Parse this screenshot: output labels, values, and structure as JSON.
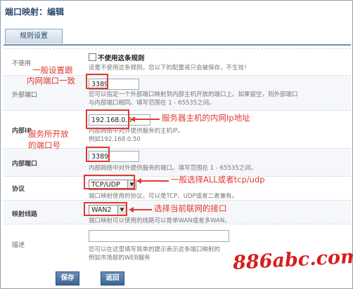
{
  "page": {
    "title": "端口映射：编辑"
  },
  "tabs": [
    {
      "label": "规则设置"
    }
  ],
  "rows": {
    "disable": {
      "label": "不使用",
      "checkbox_label": "不使用这条规则",
      "help": "设置不使用这条规则，您以下的配置将只会被保存，不生效！"
    },
    "external_port": {
      "label": "外部端口",
      "value": "3389",
      "help1": "您可以指定一个外部端口映射到内部主机开放的端口上。如果留空，则外部端口",
      "help2": "与内部端口相同。填写范围在 1 - 65535之间。"
    },
    "internal_ip": {
      "label": "内部IP",
      "value": "192.168.0.5",
      "help1": "内部网络中对外提供服务的主机IP。",
      "help2": "例如192.168.0.50"
    },
    "internal_port": {
      "label": "内部端口",
      "value": "3389",
      "help": "内部网络中对外提供服务的端口。填写范围在 1 - 65535之间。"
    },
    "protocol": {
      "label": "协议",
      "selected": "TCP/UDP",
      "help": "端口映射使用的协议，可以是TCP、UDP或者二者兼有。"
    },
    "line": {
      "label": "映射线路",
      "selected": "WAN2",
      "help": "端口映射可以使用的线路可以是单WAN或者多WAN。"
    },
    "desc": {
      "label": "描述",
      "help1": "您可以在这里填写简单的提示表示这条端口映射的",
      "help2": "例如市场部的WEB服务"
    }
  },
  "buttons": {
    "save": "保存",
    "back": "返回"
  },
  "annotations": {
    "a1_line1": "一般设置跟",
    "a1_line2": "内网端口一致",
    "a2": "服务器主机的内网Ip地址",
    "a3_line1": "服务所开放",
    "a3_line2": "的端口号",
    "a4": "一般选择ALL或者tcp/udp",
    "a5": "选择当前联网的接口"
  },
  "watermark": "886abc.com",
  "colors": {
    "annotation": "#e03a2f",
    "accent": "#3c6595",
    "watermark": "#d81e1e"
  }
}
